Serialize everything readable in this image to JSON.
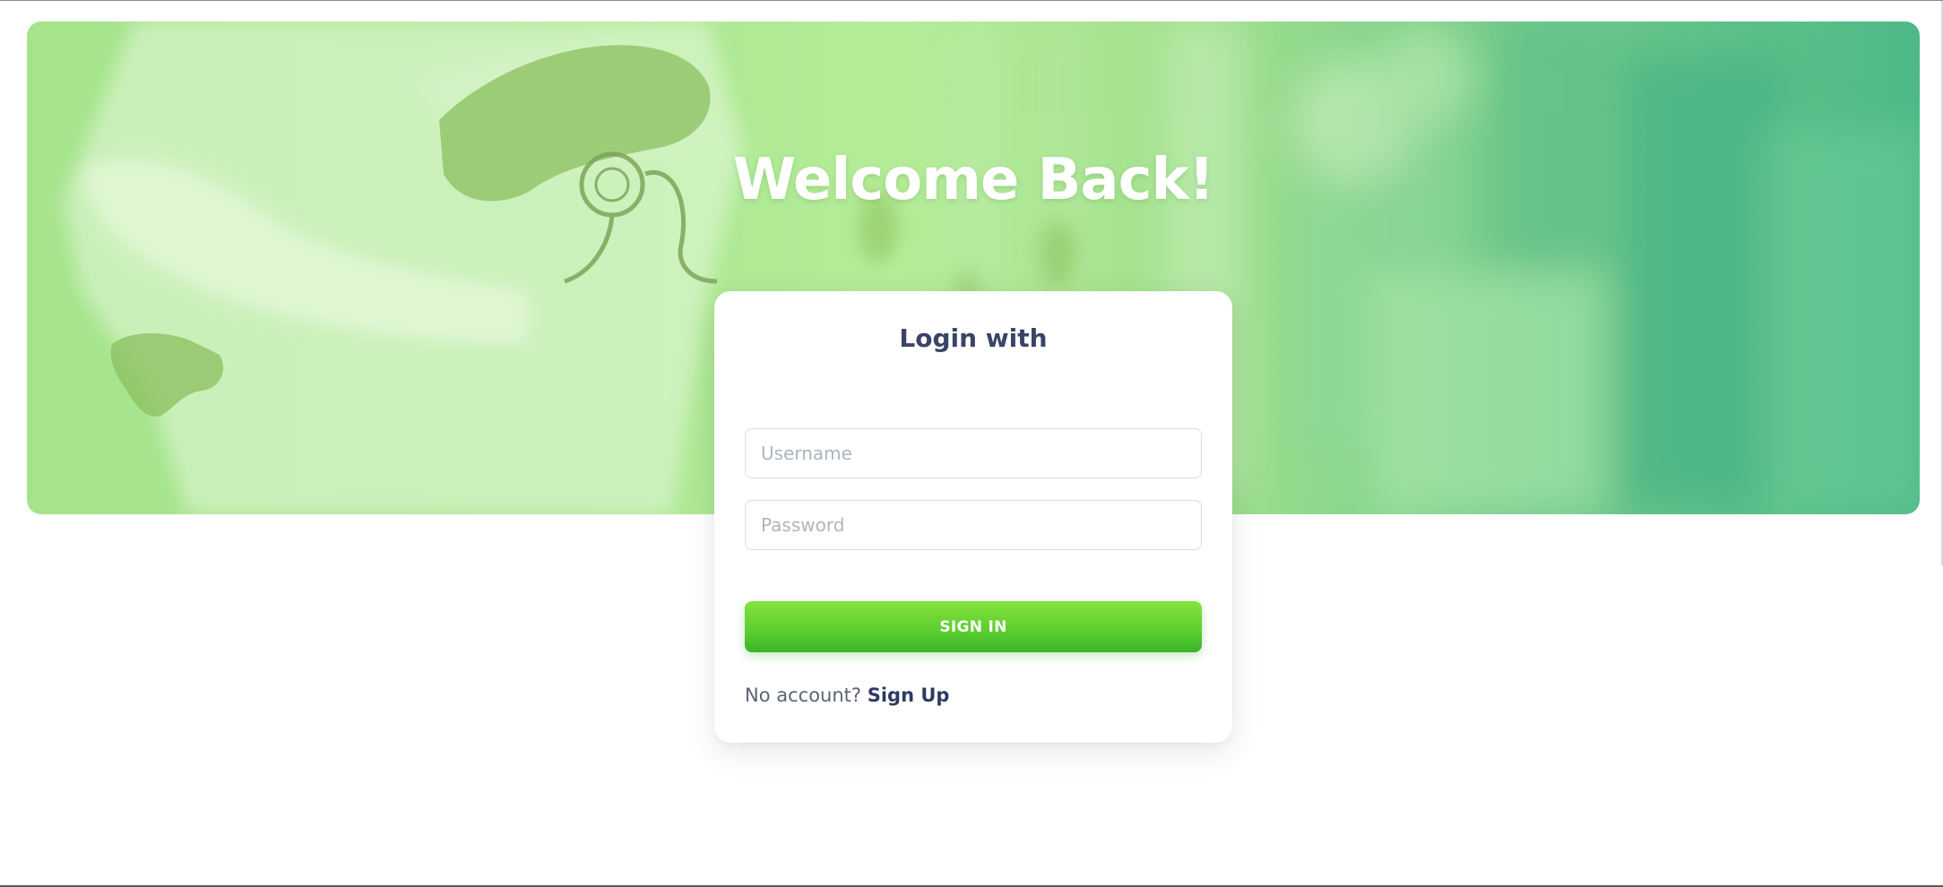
{
  "hero": {
    "title": "Welcome Back!",
    "background_image": "doctor-with-stethoscope-photo",
    "overlay_color_start": "#a6e48c",
    "overlay_color_end": "#4eb987"
  },
  "login_card": {
    "title": "Login with",
    "username_placeholder": "Username",
    "password_placeholder": "Password",
    "signin_label": "SIGN IN",
    "no_account_text": "No account?",
    "signup_label": "Sign Up"
  },
  "colors": {
    "accent_green": "#5fcf2f",
    "title_navy": "#3a4468",
    "link_navy": "#2f3a62"
  }
}
